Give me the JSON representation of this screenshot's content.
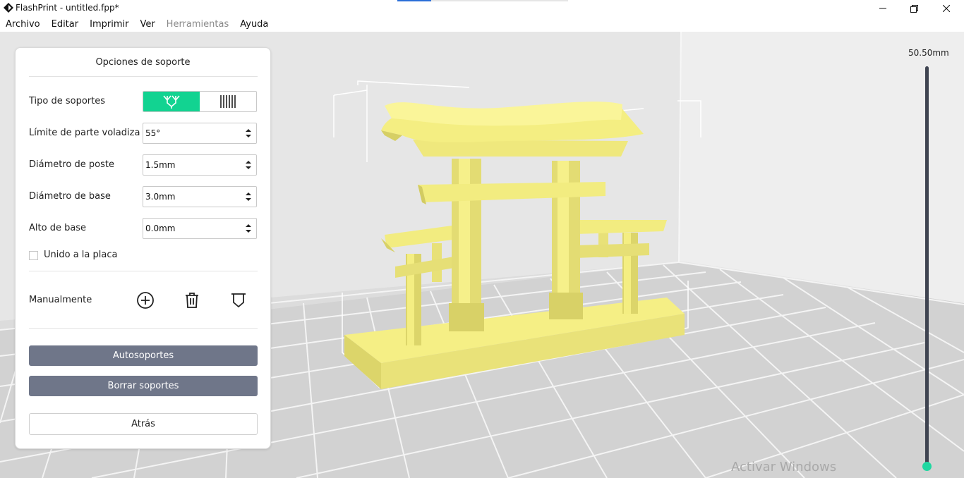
{
  "window": {
    "title": "FlashPrint - untitled.fpp*",
    "icons": [
      "app-logo-icon",
      "minimize-icon",
      "maximize-icon",
      "close-icon"
    ]
  },
  "menu": {
    "items": [
      "Archivo",
      "Editar",
      "Imprimir",
      "Ver",
      "Herramientas",
      "Ayuda"
    ],
    "disabled": [
      "Herramientas"
    ]
  },
  "panel": {
    "title": "Opciones de soporte",
    "support_type": {
      "label": "Tipo de soportes",
      "options": [
        "tree-support-icon",
        "linear-support-icon"
      ],
      "selected": "tree-support-icon",
      "active_color": "#12d391"
    },
    "fields": [
      {
        "label": "Límite de parte voladiza",
        "value": "55°"
      },
      {
        "label": "Diámetro de poste",
        "value": "1.5mm"
      },
      {
        "label": "Diámetro de base",
        "value": "3.0mm"
      },
      {
        "label": "Alto de base",
        "value": "0.0mm"
      }
    ],
    "attach_plate": {
      "label": "Unido a la placa",
      "checked": false
    },
    "manual": {
      "label": "Manualmente",
      "tools": [
        "add-support-icon",
        "delete-support-icon",
        "clear-support-icon"
      ]
    },
    "buttons": {
      "auto": "Autosoportes",
      "clear": "Borrar soportes",
      "back": "Atrás"
    },
    "button_color": "#6f7689"
  },
  "height_slider": {
    "value_label": "50.50mm",
    "track_color": "#3f4451",
    "knob_color": "#1fd8a1"
  },
  "model": {
    "color": "#f4ee82"
  },
  "watermark": "Activar Windows"
}
